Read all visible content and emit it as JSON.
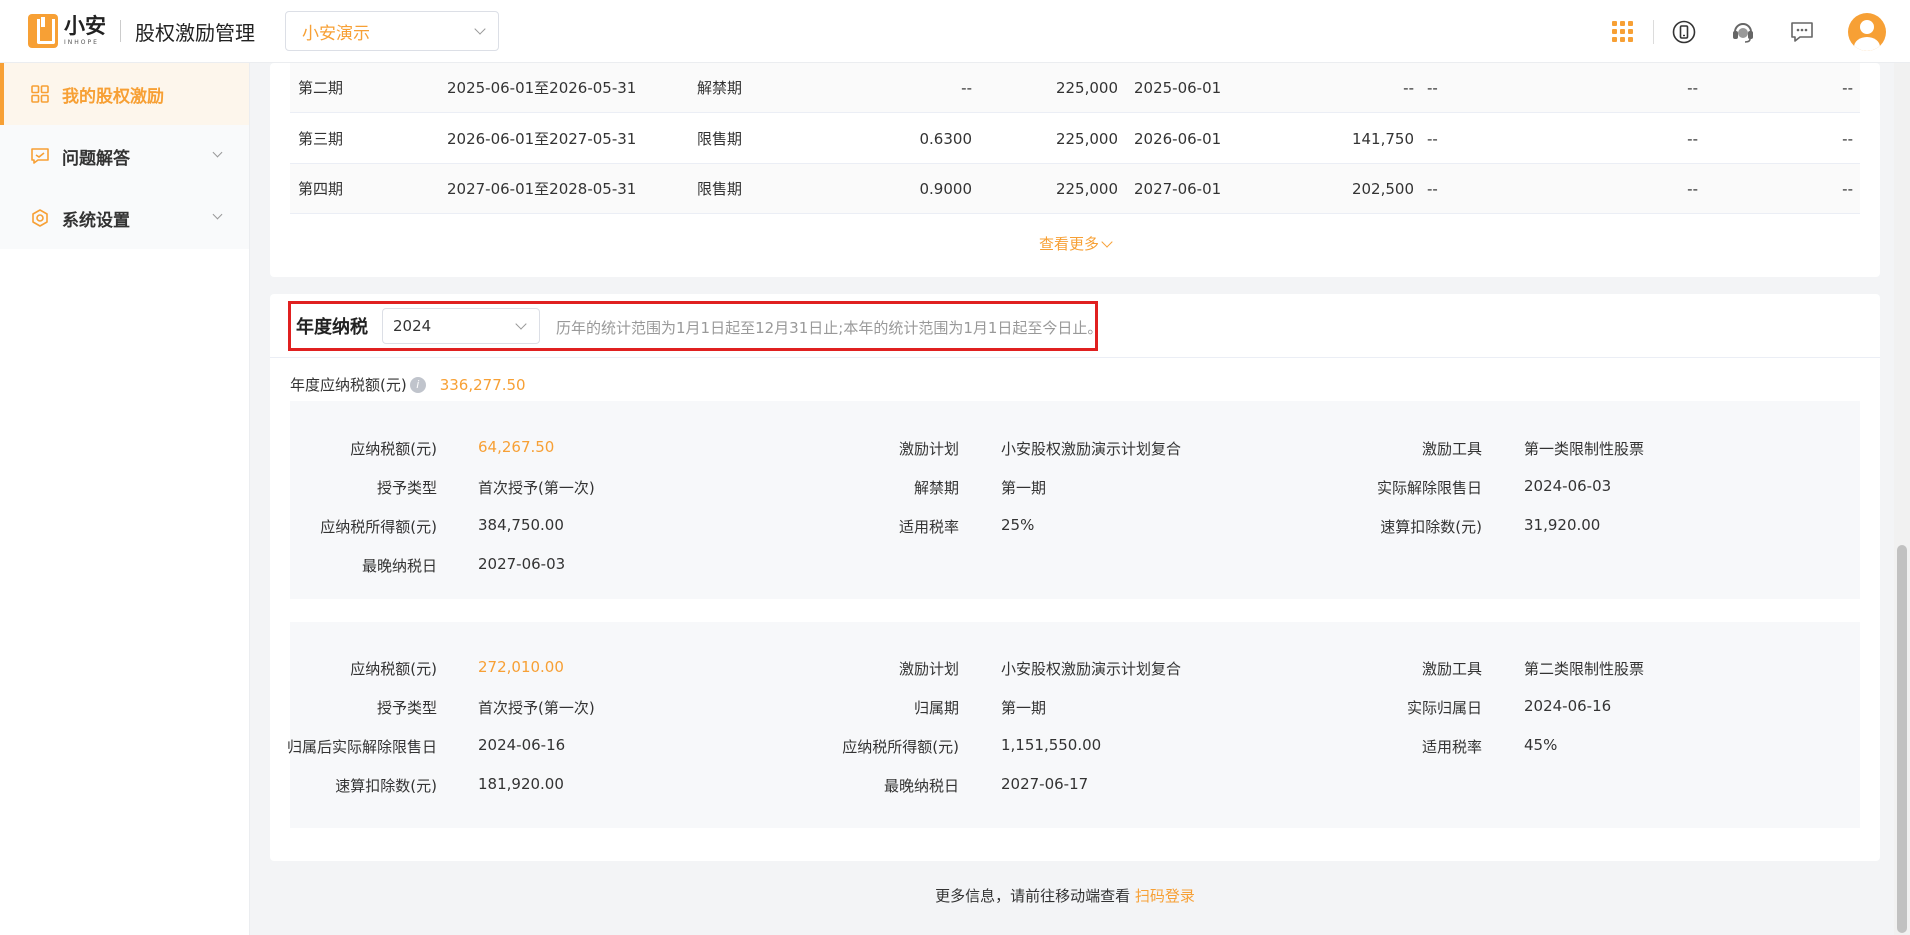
{
  "header": {
    "logo_cn": "小安",
    "logo_en": "INHOPE",
    "app_title": "股权激励管理",
    "org_selected": "小安演示"
  },
  "sidebar": {
    "items": [
      {
        "label": "我的股权激励"
      },
      {
        "label": "问题解答"
      },
      {
        "label": "系统设置"
      }
    ]
  },
  "schedule": {
    "rows": [
      {
        "period": "第二期",
        "range": "2025-06-01至2026-05-31",
        "status": "解禁期",
        "price": "--",
        "qty": "225,000",
        "date": "2025-06-01",
        "amount": "--",
        "c8": "--",
        "c9": "--",
        "c10": "--"
      },
      {
        "period": "第三期",
        "range": "2026-06-01至2027-05-31",
        "status": "限售期",
        "price": "0.6300",
        "qty": "225,000",
        "date": "2026-06-01",
        "amount": "141,750",
        "c8": "--",
        "c9": "--",
        "c10": "--"
      },
      {
        "period": "第四期",
        "range": "2027-06-01至2028-05-31",
        "status": "限售期",
        "price": "0.9000",
        "qty": "225,000",
        "date": "2027-06-01",
        "amount": "202,500",
        "c8": "--",
        "c9": "--",
        "c10": "--"
      }
    ],
    "more_label": "查看更多"
  },
  "annual_tax": {
    "title": "年度纳税",
    "year": "2024",
    "note": "历年的统计范围为1月1日起至12月31日止;本年的统计范围为1月1日起至今日止。",
    "total_label": "年度应纳税额(元)",
    "total_value": "336,277.50",
    "blocks": [
      {
        "fields": [
          {
            "label": "应纳税额(元)",
            "value": "64,267.50"
          },
          {
            "label": "激励计划",
            "value": "小安股权激励演示计划复合"
          },
          {
            "label": "激励工具",
            "value": "第一类限制性股票"
          },
          {
            "label": "授予类型",
            "value": "首次授予(第一次)"
          },
          {
            "label": "解禁期",
            "value": "第一期"
          },
          {
            "label": "实际解除限售日",
            "value": "2024-06-03"
          },
          {
            "label": "应纳税所得额(元)",
            "value": "384,750.00"
          },
          {
            "label": "适用税率",
            "value": "25%"
          },
          {
            "label": "速算扣除数(元)",
            "value": "31,920.00"
          },
          {
            "label": "最晚纳税日",
            "value": "2027-06-03"
          }
        ]
      },
      {
        "fields": [
          {
            "label": "应纳税额(元)",
            "value": "272,010.00"
          },
          {
            "label": "激励计划",
            "value": "小安股权激励演示计划复合"
          },
          {
            "label": "激励工具",
            "value": "第二类限制性股票"
          },
          {
            "label": "授予类型",
            "value": "首次授予(第一次)"
          },
          {
            "label": "归属期",
            "value": "第一期"
          },
          {
            "label": "实际归属日",
            "value": "2024-06-16"
          },
          {
            "label": "归属后实际解除限售日",
            "value": "2024-06-16"
          },
          {
            "label": "应纳税所得额(元)",
            "value": "1,151,550.00"
          },
          {
            "label": "适用税率",
            "value": "45%"
          },
          {
            "label": "速算扣除数(元)",
            "value": "181,920.00"
          },
          {
            "label": "最晚纳税日",
            "value": "2027-06-17"
          }
        ]
      }
    ]
  },
  "footer": {
    "text": "更多信息，请前往移动端查看",
    "link": "扫码登录"
  },
  "colors": {
    "accent": "#f7a035",
    "highlight_border": "#e02020"
  }
}
